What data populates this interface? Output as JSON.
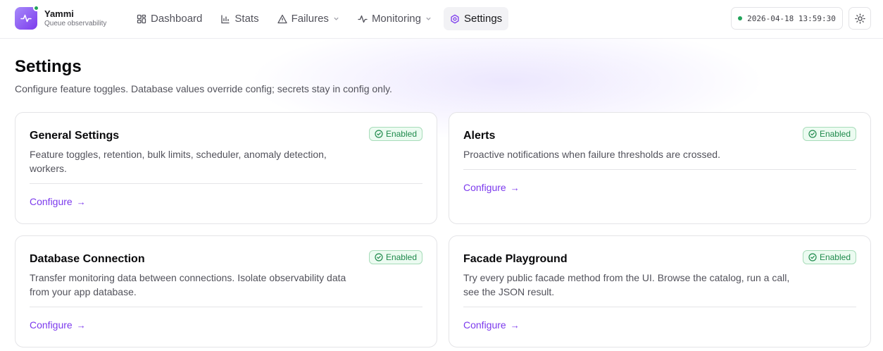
{
  "brand": {
    "name": "Yammi",
    "subtitle": "Queue observability"
  },
  "nav": {
    "items": [
      {
        "label": "Dashboard",
        "icon": "dashboard-icon"
      },
      {
        "label": "Stats",
        "icon": "bar-chart-icon"
      },
      {
        "label": "Failures",
        "icon": "warning-icon",
        "has_dropdown": true
      },
      {
        "label": "Monitoring",
        "icon": "activity-icon",
        "has_dropdown": true
      },
      {
        "label": "Settings",
        "icon": "gear-icon",
        "active": true
      }
    ]
  },
  "header": {
    "clock": "2026-04-18 13:59:30",
    "theme_icon": "sun-icon"
  },
  "page": {
    "title": "Settings",
    "description": "Configure feature toggles. Database values override config; secrets stay in config only."
  },
  "cards": [
    {
      "title": "General Settings",
      "description": "Feature toggles, retention, bulk limits, scheduler, anomaly detection, workers.",
      "badge": "Enabled",
      "action": "Configure"
    },
    {
      "title": "Alerts",
      "description": "Proactive notifications when failure thresholds are crossed.",
      "badge": "Enabled",
      "action": "Configure"
    },
    {
      "title": "Database Connection",
      "description": "Transfer monitoring data between connections. Isolate observability data from your app database.",
      "badge": "Enabled",
      "action": "Configure"
    },
    {
      "title": "Facade Playground",
      "description": "Try every public facade method from the UI. Browse the catalog, run a call, see the JSON result.",
      "badge": "Enabled",
      "action": "Configure"
    }
  ],
  "colors": {
    "accent": "#7c3aed",
    "success": "#22a35a",
    "badge_bg": "#ecfbf1"
  }
}
